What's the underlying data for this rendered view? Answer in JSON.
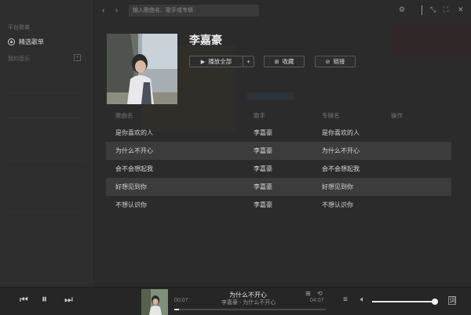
{
  "sidebar": {
    "section_header": "平台歌单",
    "active_item": "精选歌单",
    "my_music_header": "我的音乐",
    "add_label": "+"
  },
  "topbar": {
    "back_icon": "chevron-left-icon",
    "forward_icon": "chevron-right-icon",
    "search_placeholder": "输入歌曲名、歌手或专辑"
  },
  "playlist": {
    "title": "李嘉豪",
    "play_all_label": "播放全部",
    "add_label": "+",
    "favorite_label": "收藏",
    "link_label": "链接"
  },
  "table": {
    "headers": [
      "歌曲名",
      "歌手",
      "专辑名",
      "操作"
    ],
    "rows": [
      {
        "song": "是你喜欢的人",
        "artist": "李嘉豪",
        "album": "是你喜欢的人"
      },
      {
        "song": "为什么不开心",
        "artist": "李嘉豪",
        "album": "为什么不开心"
      },
      {
        "song": "会不会想起我",
        "artist": "李嘉豪",
        "album": "会不会想起我"
      },
      {
        "song": "好想见到你",
        "artist": "李嘉豪",
        "album": "好想见到你"
      },
      {
        "song": "不想认识你",
        "artist": "李嘉豪",
        "album": "不想认识你"
      }
    ]
  },
  "player": {
    "now_playing_title": "为什么不开心",
    "now_playing_subtitle": "李嘉豪 - 为什么不开心",
    "current_time": "00:07",
    "total_time": "04:07",
    "progress": 0.03,
    "volume": 1.0
  },
  "colors": {
    "background": "#2b2b2b",
    "row_highlight": "#3c3c3c",
    "text": "#d7d7d7",
    "muted": "#777777"
  }
}
